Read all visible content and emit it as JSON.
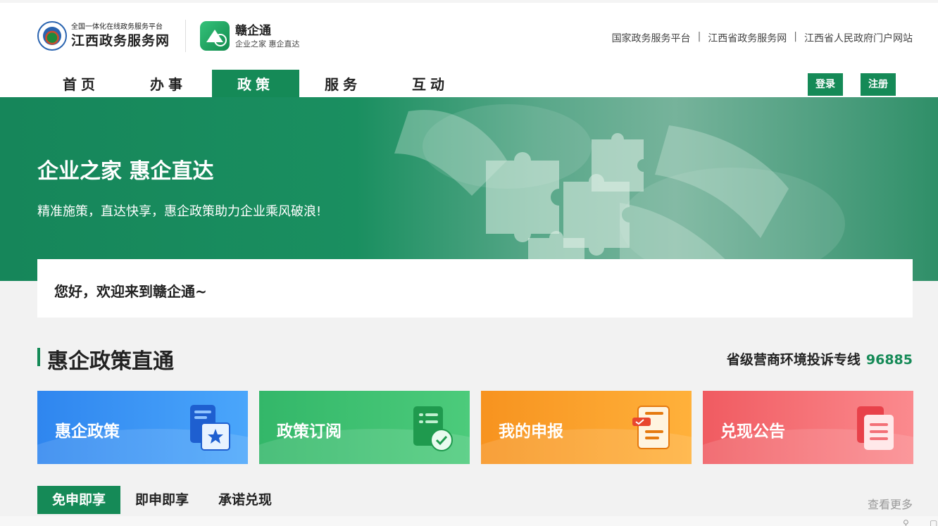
{
  "header": {
    "platform_small": "全国一体化在线政务服务平台",
    "platform_name": "江西政务服务网",
    "app_name": "赣企通",
    "app_sub": "企业之家 惠企直达",
    "top_links": [
      "国家政务服务平台",
      "江西省政务服务网",
      "江西省人民政府门户网站"
    ],
    "link_separator": "|",
    "nav": [
      "首页",
      "办事",
      "政策",
      "服务",
      "互动"
    ],
    "nav_active": "政策",
    "login": "登录",
    "register": "注册"
  },
  "banner": {
    "title": "企业之家 惠企直达",
    "subtitle": "精准施策，直达快享，惠企政策助力企业乘风破浪!"
  },
  "welcome": {
    "text": "您好，欢迎来到赣企通~"
  },
  "section": {
    "title": "惠企政策直通",
    "hotline_label": "省级营商环境投诉专线",
    "hotline_number": "96885"
  },
  "cards": [
    {
      "label": "惠企政策",
      "color": "#2f86ef",
      "icon": "policy-book-icon"
    },
    {
      "label": "政策订阅",
      "color": "#33b769",
      "icon": "subscribe-scroll-icon"
    },
    {
      "label": "我的申报",
      "color": "#f7931f",
      "icon": "declaration-doc-icon"
    },
    {
      "label": "兑现公告",
      "color": "#f05b61",
      "icon": "announcement-doc-icon"
    }
  ],
  "tabs": [
    "免申即享",
    "即申即享",
    "承诺兑现"
  ],
  "tab_active": "免申即享",
  "more": "查看更多",
  "colors": {
    "brand_green": "#158a57"
  }
}
